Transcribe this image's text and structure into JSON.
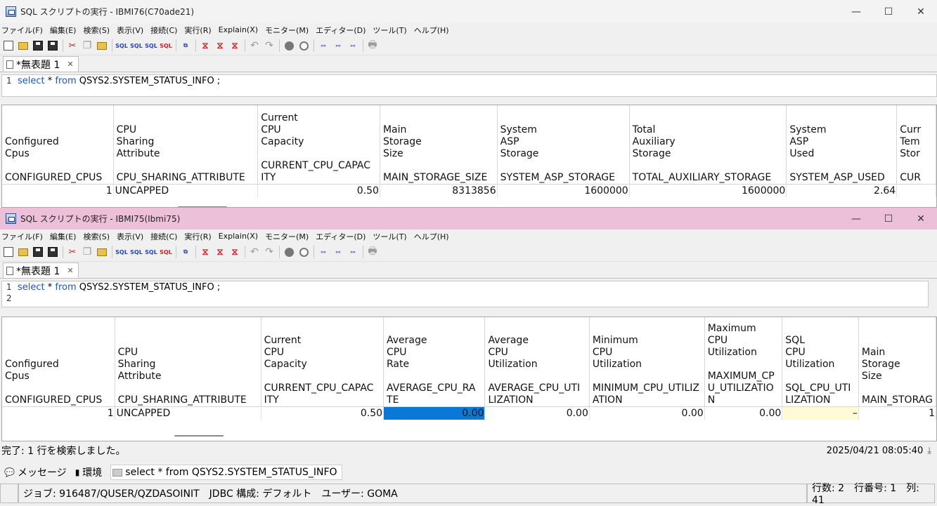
{
  "windows": [
    {
      "title": "SQL スクリプトの実行 - IBMI76(C70ade21)",
      "menu": [
        "ファイル(F)",
        "編集(E)",
        "検索(S)",
        "表示(V)",
        "接続(C)",
        "実行(R)",
        "Explain(X)",
        "モニター(M)",
        "エディター(D)",
        "ツール(T)",
        "ヘルプ(H)"
      ],
      "tab": "*無表題 1",
      "editor_lines": [
        {
          "no": "1",
          "tokens": [
            {
              "t": "select",
              "kw": true
            },
            {
              "t": " * ",
              "kw": false
            },
            {
              "t": "from",
              "kw": true
            },
            {
              "t": " QSYS2.SYSTEM_STATUS_INFO ;",
              "kw": false
            }
          ]
        }
      ],
      "columns": [
        {
          "header": "\n\nConfigured\nCpus\n\nCONFIGURED_CPUS",
          "value": "1",
          "align": "num"
        },
        {
          "header": "\nCPU\nSharing\nAttribute\n\nCPU_SHARING_ATTRIBUTE",
          "value": "UNCAPPED",
          "align": "txt"
        },
        {
          "header": "Current\nCPU\nCapacity\n\nCURRENT_CPU_CAPAC\nITY",
          "value": "0.50",
          "align": "num"
        },
        {
          "header": "\nMain\nStorage\nSize\n\nMAIN_STORAGE_SIZE",
          "value": "8313856",
          "align": "num"
        },
        {
          "header": "\nSystem\nASP\nStorage\n\nSYSTEM_ASP_STORAGE",
          "value": "1600000",
          "align": "num"
        },
        {
          "header": "\nTotal\nAuxiliary\nStorage\n\nTOTAL_AUXILIARY_STORAGE",
          "value": "1600000",
          "align": "num"
        },
        {
          "header": "\nSystem\nASP\nUsed\n\nSYSTEM_ASP_USED",
          "value": "2.64",
          "align": "num"
        },
        {
          "header": "\nCurr\nTem\nStor\n\nCUR",
          "value": "",
          "align": "num"
        }
      ]
    },
    {
      "title": "SQL スクリプトの実行 - IBMI75(Ibmi75)",
      "menu": [
        "ファイル(F)",
        "編集(E)",
        "検索(S)",
        "表示(V)",
        "接続(C)",
        "実行(R)",
        "Explain(X)",
        "モニター(M)",
        "エディター(D)",
        "ツール(T)",
        "ヘルプ(H)"
      ],
      "tab": "*無表題 1",
      "editor_lines": [
        {
          "no": "1",
          "tokens": [
            {
              "t": "select",
              "kw": true
            },
            {
              "t": " * ",
              "kw": false
            },
            {
              "t": "from",
              "kw": true
            },
            {
              "t": " QSYS2.SYSTEM_STATUS_INFO ;",
              "kw": false
            }
          ]
        },
        {
          "no": "2",
          "tokens": []
        }
      ],
      "columns": [
        {
          "header": "\n\n\nConfigured\nCpus\n\nCONFIGURED_CPUS",
          "value": "1",
          "align": "num"
        },
        {
          "header": "\n\nCPU\nSharing\nAttribute\n\nCPU_SHARING_ATTRIBUTE",
          "value": "UNCAPPED",
          "align": "txt"
        },
        {
          "header": "\nCurrent\nCPU\nCapacity\n\nCURRENT_CPU_CAPAC\nITY",
          "value": "0.50",
          "align": "num"
        },
        {
          "header": "\nAverage\nCPU\nRate\n\nAVERAGE_CPU_RA\nTE",
          "value": "0.00",
          "align": "sel"
        },
        {
          "header": "\nAverage\nCPU\nUtilization\n\nAVERAGE_CPU_UTI\nLIZATION",
          "value": "0.00",
          "align": "num"
        },
        {
          "header": "\nMinimum\nCPU\nUtilization\n\nMINIMUM_CPU_UTILIZ\nATION",
          "value": "0.00",
          "align": "num"
        },
        {
          "header": "Maximum\nCPU\nUtilization\n\nMAXIMUM_CP\nU_UTILIZATIO\nN",
          "value": "0.00",
          "align": "num"
        },
        {
          "header": "\nSQL\nCPU\nUtilization\n\nSQL_CPU_UTI\nLIZATION",
          "value": "–",
          "align": "null"
        },
        {
          "header": "\n\nMain\nStorage\nSize\n\nMAIN_STORAG",
          "value": "1",
          "align": "num"
        }
      ]
    }
  ],
  "status": {
    "message": "完了: 1 行を検索しました。",
    "timestamp": "2025/04/21 08:05:40"
  },
  "bottom_tabs": {
    "messages": "メッセージ",
    "environment": "環境",
    "query": "select * from QSYS2.SYSTEM_STATUS_INFO"
  },
  "job_bar": {
    "job": "ジョブ: 916487/QUSER/QZDASOINIT　JDBC 構成: デフォルト　ユーザー: GOMA",
    "position": "行数: 2　行番号: 1　列: 41"
  }
}
